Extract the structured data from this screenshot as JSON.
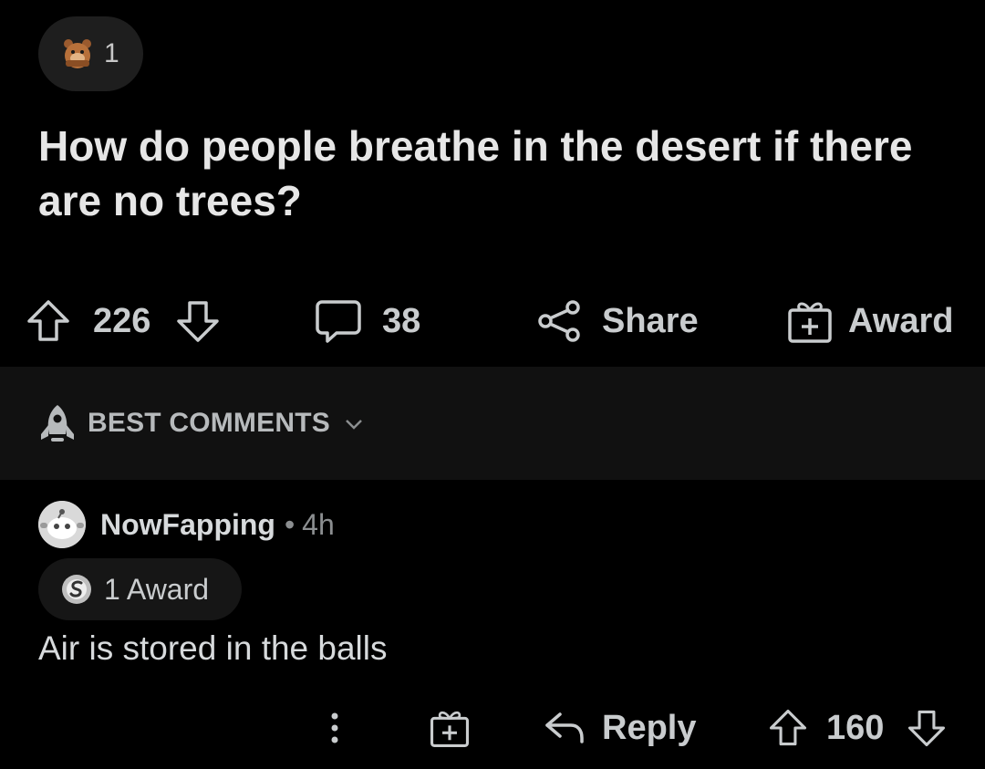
{
  "post": {
    "award_count": "1",
    "title": "How do people breathe in the desert if there are no trees?",
    "votes": "226",
    "comments": "38",
    "share_label": "Share",
    "award_label": "Award"
  },
  "sort": {
    "label": "BEST COMMENTS"
  },
  "comment": {
    "username": "NowFapping",
    "separator": "•",
    "age": "4h",
    "award_label": "1 Award",
    "body": "Air is stored in the balls",
    "reply_label": "Reply",
    "votes": "160"
  },
  "icons": {
    "post_award": "bear-award-icon",
    "upvote": "arrow-up-outline-icon",
    "downvote": "arrow-down-outline-icon",
    "comment": "speech-bubble-icon",
    "share": "share-nodes-icon",
    "award": "gift-box-icon",
    "sort": "rocket-icon",
    "chevron": "chevron-down-icon",
    "avatar": "snoo-avatar-icon",
    "silver_award": "silver-award-icon",
    "more": "more-vertical-icon",
    "reply": "reply-arrow-icon"
  },
  "colors": {
    "background": "#000000",
    "sort_bar": "#111111",
    "pill": "#1e1e1e",
    "text": "#d7dadc",
    "muted": "#8b8e90"
  }
}
